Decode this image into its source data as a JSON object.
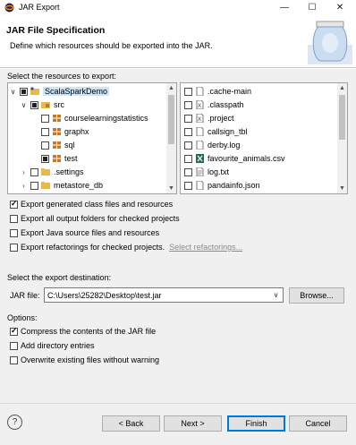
{
  "window": {
    "title": "JAR Export"
  },
  "header": {
    "title": "JAR File Specification",
    "description": "Define which resources should be exported into the JAR."
  },
  "resources": {
    "label": "Select the resources to export:",
    "tree": [
      {
        "label": "ScalaSparkDemo",
        "icon": "project-icon",
        "state": "partial",
        "expanded": true
      },
      {
        "label": "src",
        "icon": "package-folder-icon",
        "state": "partial",
        "expanded": true
      },
      {
        "label": "courselearningstatistics",
        "icon": "package-icon",
        "state": "unchecked"
      },
      {
        "label": "graphx",
        "icon": "package-icon",
        "state": "unchecked"
      },
      {
        "label": "sql",
        "icon": "package-icon",
        "state": "unchecked"
      },
      {
        "label": "test",
        "icon": "package-icon",
        "state": "partial"
      },
      {
        "label": ".settings",
        "icon": "folder-icon",
        "state": "unchecked",
        "expanded": false
      },
      {
        "label": "metastore_db",
        "icon": "folder-icon",
        "state": "unchecked",
        "expanded": false
      }
    ],
    "files": [
      {
        "label": ".cache-main",
        "icon": "file-icon"
      },
      {
        "label": ".classpath",
        "icon": "xml-file-icon"
      },
      {
        "label": ".project",
        "icon": "xml-file-icon"
      },
      {
        "label": "callsign_tbl",
        "icon": "file-icon"
      },
      {
        "label": "derby.log",
        "icon": "file-icon"
      },
      {
        "label": "favourite_animals.csv",
        "icon": "csv-file-icon"
      },
      {
        "label": "log.txt",
        "icon": "text-file-icon"
      },
      {
        "label": "pandainfo.json",
        "icon": "file-icon"
      }
    ]
  },
  "export_options": [
    {
      "label": "Export generated class files and resources",
      "checked": true
    },
    {
      "label": "Export all output folders for checked projects",
      "checked": false
    },
    {
      "label": "Export Java source files and resources",
      "checked": false
    },
    {
      "label": "Export refactorings for checked projects.",
      "checked": false
    }
  ],
  "select_refactorings_link": "Select refactorings...",
  "destination": {
    "label": "Select the export destination:",
    "jar_label": "JAR file:",
    "jar_value": "C:\\Users\\25282\\Desktop\\test.jar",
    "browse_label": "Browse..."
  },
  "options": {
    "label": "Options:",
    "items": [
      {
        "label": "Compress the contents of the JAR file",
        "checked": true
      },
      {
        "label": "Add directory entries",
        "checked": false
      },
      {
        "label": "Overwrite existing files without warning",
        "checked": false
      }
    ]
  },
  "buttons": {
    "help": "?",
    "back": "< Back",
    "next": "Next >",
    "finish": "Finish",
    "cancel": "Cancel"
  },
  "colors": {
    "link": "#8a8a8a",
    "default_button": "#0078d7",
    "folder": "#e8b84a",
    "package": "#c8762a"
  }
}
